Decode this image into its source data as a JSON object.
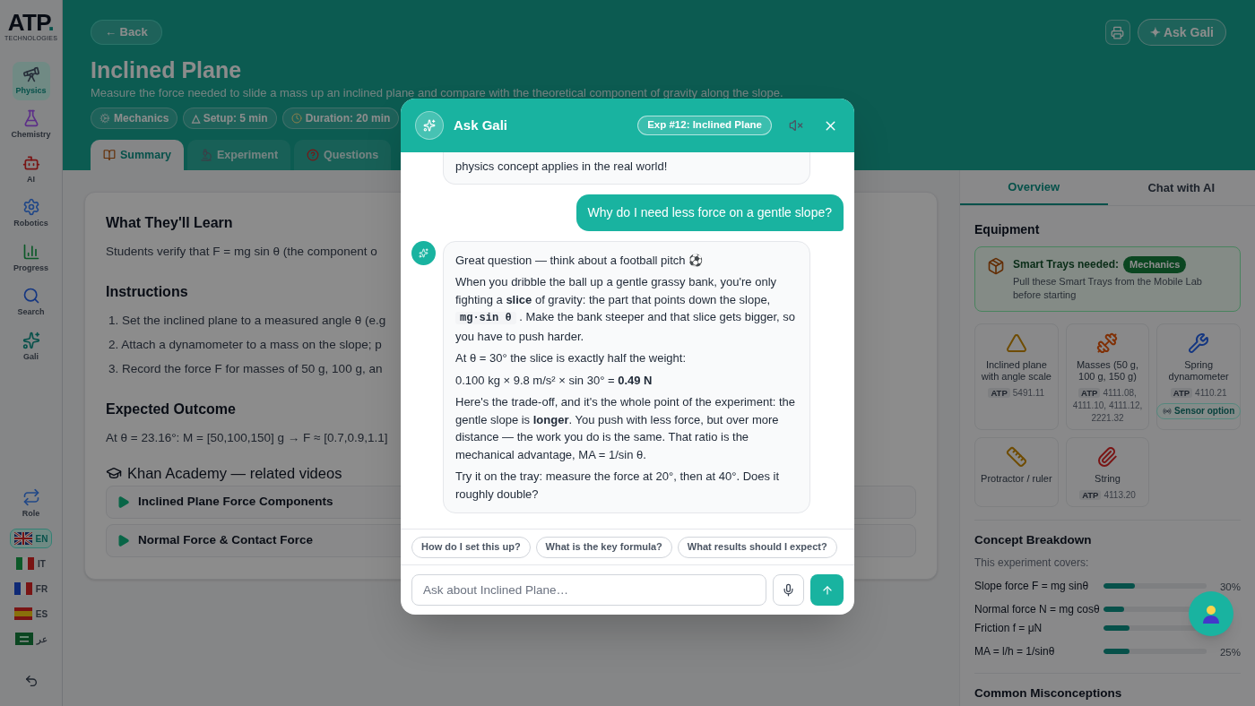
{
  "sidebar": {
    "logo": {
      "text": "ATP",
      "dot": ".",
      "tagline": "TECHNOLOGIES"
    },
    "nav": [
      {
        "label": "Physics",
        "selected": true
      },
      {
        "label": "Chemistry",
        "selected": false
      },
      {
        "label": "AI",
        "selected": false
      },
      {
        "label": "Robotics",
        "selected": false
      },
      {
        "label": "Progress",
        "selected": false
      },
      {
        "label": "Search",
        "selected": false
      },
      {
        "label": "Gali",
        "selected": false
      }
    ],
    "role": {
      "label": "Role"
    },
    "languages": [
      {
        "code": "EN",
        "selected": true
      },
      {
        "code": "IT",
        "selected": false
      },
      {
        "code": "FR",
        "selected": false
      },
      {
        "code": "ES",
        "selected": false
      },
      {
        "code": "عر",
        "selected": false
      }
    ]
  },
  "header": {
    "back": "← Back",
    "title": "Inclined Plane",
    "subtitle": "Measure the force needed to slide a mass up an inclined plane and compare with the theoretical component of gravity along the slope.",
    "chips": [
      {
        "kind": "topic",
        "text": "Mechanics"
      },
      {
        "kind": "plain",
        "text": "△ Setup: 5 min"
      },
      {
        "kind": "time",
        "text": "Duration: 20 min"
      }
    ],
    "tabs": [
      {
        "label": "Summary",
        "selected": true
      },
      {
        "label": "Experiment",
        "selected": false
      },
      {
        "label": "Questions",
        "selected": false
      }
    ],
    "ask_button": "✦ Ask Gali"
  },
  "summary": {
    "sections": [
      {
        "heading": "What They'll Learn",
        "kind": "text",
        "lines": [
          "Students verify that F = mg sin θ (the component o"
        ]
      },
      {
        "heading": "Instructions",
        "kind": "list",
        "lines": [
          "1. Set the inclined plane to a measured angle θ (e.g",
          "2. Attach a dynamometer to a mass on the slope; p",
          "3. Record the force F for masses of 50 g, 100 g, an"
        ]
      },
      {
        "heading": "Expected Outcome",
        "kind": "text",
        "lines": [
          "At θ = 23.16°: M = [50,100,150] g → F ≈ [0.7,0.9,1.1]"
        ]
      }
    ],
    "videos": {
      "heading": "Khan Academy — related videos",
      "items": [
        "Inclined Plane Force Components",
        "Normal Force & Contact Force"
      ]
    }
  },
  "right_panel": {
    "tabs": [
      {
        "label": "Overview",
        "selected": true
      },
      {
        "label": "Chat with AI",
        "selected": false
      }
    ],
    "equipment": {
      "heading": "Equipment",
      "notice": {
        "title": "Smart Trays needed:",
        "tag": "Mechanics",
        "text": "Pull these Smart Trays from the Mobile Lab before starting"
      },
      "items": [
        {
          "name": "Inclined plane with angle scale",
          "badge": "ATP",
          "code": "5491.11"
        },
        {
          "name": "Masses (50 g, 100 g, 150 g)",
          "badge": "ATP",
          "code": "4111.08, 4111.10, 4111.12, 2221.32"
        },
        {
          "name": "Spring dynamometer",
          "badge": "ATP",
          "code": "4110.21",
          "tag": "Sensor option"
        },
        {
          "name": "Protractor / ruler"
        },
        {
          "name": "String",
          "badge": "ATP",
          "code": "4113.20"
        }
      ]
    },
    "concepts": {
      "heading": "Concept Breakdown",
      "intro": "This experiment covers:",
      "rows": [
        {
          "label": "Slope force F = mg sinθ",
          "level": 0.3,
          "reading": "30%"
        },
        {
          "label": "Normal force N = mg cosθ",
          "level": 0.2
        },
        {
          "label": "Friction f = μN",
          "level": 0.25
        },
        {
          "label": "MA = l/h = 1/sinθ",
          "level": 0.25,
          "reading": "25%"
        }
      ]
    },
    "next_heading": "Common Misconceptions"
  },
  "modal": {
    "title": "Ask Gali",
    "badge": "Exp #12: Inclined Plane",
    "muted": true,
    "messages": [
      {
        "kind": "bot",
        "avatar": false,
        "paragraphs": [
          [
            {
              "text": "physics concept applies in the real world!"
            }
          ]
        ]
      },
      {
        "kind": "user",
        "text": "Why do I need less force on a gentle slope?"
      },
      {
        "kind": "bot",
        "avatar": true,
        "paragraphs": [
          [
            {
              "text": "Great question — think about a football pitch ⚽"
            }
          ],
          [
            {
              "text": "When you dribble the ball up a gentle grassy bank, you're only fighting a **slice** of gravity: the part that points down the slope, "
            },
            {
              "kind": "code",
              "text": "mg·sin θ"
            },
            {
              "text": " . Make the bank steeper and that slice gets bigger, so you have to push harder."
            }
          ],
          [
            {
              "text": "At θ = 30° the slice is exactly half the weight:"
            }
          ],
          [
            {
              "text": "0.100 kg × 9.8 m/s² × sin 30° = **0.49 N**"
            }
          ],
          [
            {
              "text": "Here's the trade-off, and it's the whole point of the experiment: the gentle slope is **longer**. You push with less force, but over more distance — the work you do is the same. That ratio is the mechanical advantage, MA = 1/sin θ."
            }
          ],
          [
            {
              "text": "Try it on the tray: measure the force at 20°, then at 40°. Does it roughly double?"
            }
          ]
        ]
      }
    ],
    "suggestions": [
      "How do I set this up?",
      "What is the key formula?",
      "What results should I expect?"
    ],
    "input": {
      "placeholder": "Ask about Inclined Plane…"
    }
  }
}
